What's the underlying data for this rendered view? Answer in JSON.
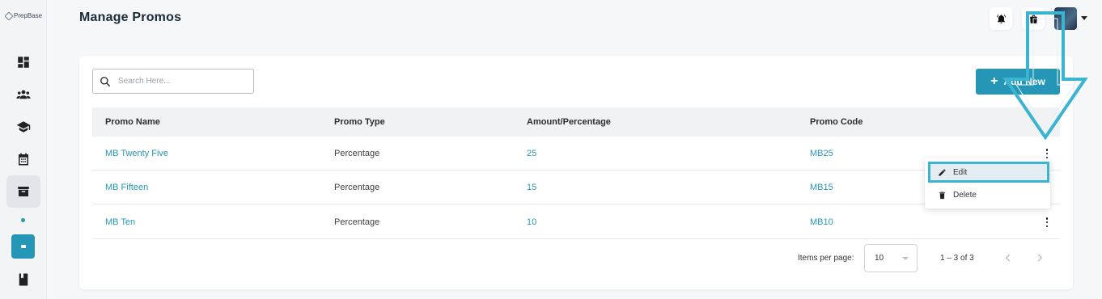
{
  "sidebar": {
    "logo_text": "PrepBase",
    "items": [
      {
        "icon": "dashboard-icon"
      },
      {
        "icon": "users-icon"
      },
      {
        "icon": "graduation-cap-icon"
      },
      {
        "icon": "calendar-icon"
      },
      {
        "icon": "archive-box-icon",
        "active": true
      },
      {
        "icon": "sub-item-icon"
      },
      {
        "icon": "book-icon"
      }
    ]
  },
  "header": {
    "title": "Manage Promos",
    "icons": [
      "bell-icon",
      "shopping-bag-icon",
      "avatar"
    ]
  },
  "toolbar": {
    "search_placeholder": "Search Here...",
    "add_label": "Add New"
  },
  "table": {
    "columns": [
      "Promo Name",
      "Promo Type",
      "Amount/Percentage",
      "Promo Code"
    ],
    "rows": [
      {
        "name": "MB Twenty Five",
        "type": "Percentage",
        "amount": "25",
        "code": "MB25"
      },
      {
        "name": "MB Fifteen",
        "type": "Percentage",
        "amount": "15",
        "code": "MB15"
      },
      {
        "name": "MB Ten",
        "type": "Percentage",
        "amount": "10",
        "code": "MB10"
      }
    ]
  },
  "context_menu": {
    "edit_label": "Edit",
    "delete_label": "Delete"
  },
  "pagination": {
    "items_per_page_label": "Items per page:",
    "items_per_page_value": "10",
    "range_label": "1 – 3 of 3"
  },
  "colors": {
    "accent": "#2596b6",
    "highlight": "#3bb4d2"
  }
}
